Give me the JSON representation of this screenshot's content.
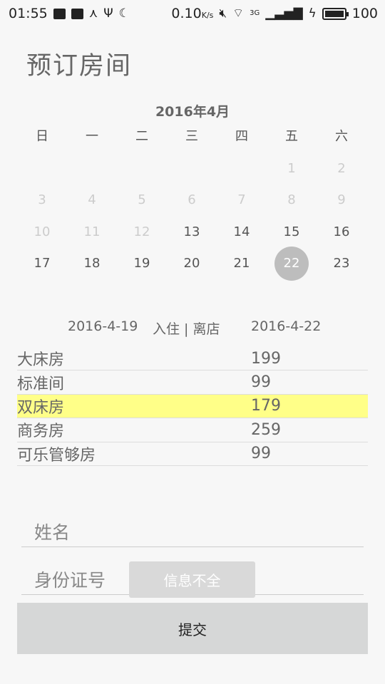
{
  "status_bar": {
    "time": "01:55",
    "speed": "0.10",
    "speed_unit": "K/s",
    "network": "3G",
    "battery": "100"
  },
  "page": {
    "title": "预订房间"
  },
  "calendar": {
    "month_label": "2016年4月",
    "weekdays": [
      "日",
      "一",
      "二",
      "三",
      "四",
      "五",
      "六"
    ],
    "weeks": [
      [
        "",
        "",
        "",
        "",
        "",
        "1",
        "2"
      ],
      [
        "3",
        "4",
        "5",
        "6",
        "7",
        "8",
        "9"
      ],
      [
        "10",
        "11",
        "12",
        "13",
        "14",
        "15",
        "16"
      ],
      [
        "17",
        "18",
        "19",
        "20",
        "21",
        "22",
        "23"
      ]
    ],
    "first_enabled_day": 13,
    "selected_day": 22
  },
  "booking": {
    "checkin_date": "2016-4-19",
    "range_label": "入住 | 离店",
    "checkout_date": "2016-4-22"
  },
  "rooms": [
    {
      "name": "大床房",
      "price": "199",
      "highlighted": false
    },
    {
      "name": "标准间",
      "price": "99",
      "highlighted": false
    },
    {
      "name": "双床房",
      "price": "179",
      "highlighted": true
    },
    {
      "name": "商务房",
      "price": "259",
      "highlighted": false
    },
    {
      "name": "可乐管够房",
      "price": "99",
      "highlighted": false
    }
  ],
  "form": {
    "name_placeholder": "姓名",
    "id_placeholder": "身份证号",
    "submit_label": "提交"
  },
  "toast": {
    "message": "信息不全"
  },
  "colors": {
    "highlight": "#ffff88",
    "selected_day": "#bdbdbd",
    "button": "#d6d7d7"
  }
}
